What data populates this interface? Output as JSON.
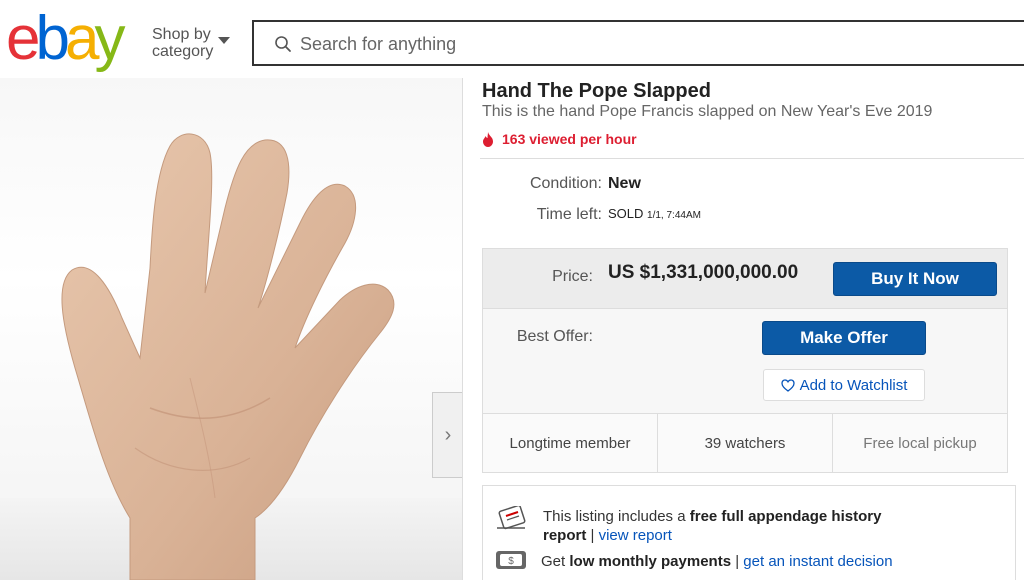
{
  "header": {
    "logo": [
      "e",
      "b",
      "a",
      "y"
    ],
    "logo_colors": [
      "#e53238",
      "#0064d2",
      "#f5af02",
      "#86b817"
    ],
    "shop_by_line1": "Shop by",
    "shop_by_line2": "category",
    "search_placeholder": "Search for anything"
  },
  "listing": {
    "title": "Hand The Pope Slapped",
    "subtitle": "This is the hand Pope Francis slapped on New Year's Eve 2019",
    "viewed_text": "163 viewed per hour",
    "condition_label": "Condition:",
    "condition_value": "New",
    "time_left_label": "Time left:",
    "time_left_status": "SOLD",
    "time_left_time": "1/1, 7:44AM",
    "price_label": "Price:",
    "price_value": "US $1,331,000,000.00",
    "buy_now_label": "Buy It Now",
    "best_offer_label": "Best Offer:",
    "make_offer_label": "Make Offer",
    "watchlist_label": "Add to Watchlist",
    "stats": [
      "Longtime member",
      "39 watchers",
      "Free local pickup"
    ]
  },
  "promo": {
    "history_prefix": "This listing includes a ",
    "history_bold": "free full appendage history report",
    "history_sep": " | ",
    "history_link": "view report",
    "payments_prefix": "Get ",
    "payments_bold": "low monthly payments",
    "payments_sep": " | ",
    "payments_link": "get an instant decision"
  },
  "colors": {
    "accent_blue": "#0c5aa6",
    "alert_red": "#dd1e31",
    "link_blue": "#0654ba"
  }
}
